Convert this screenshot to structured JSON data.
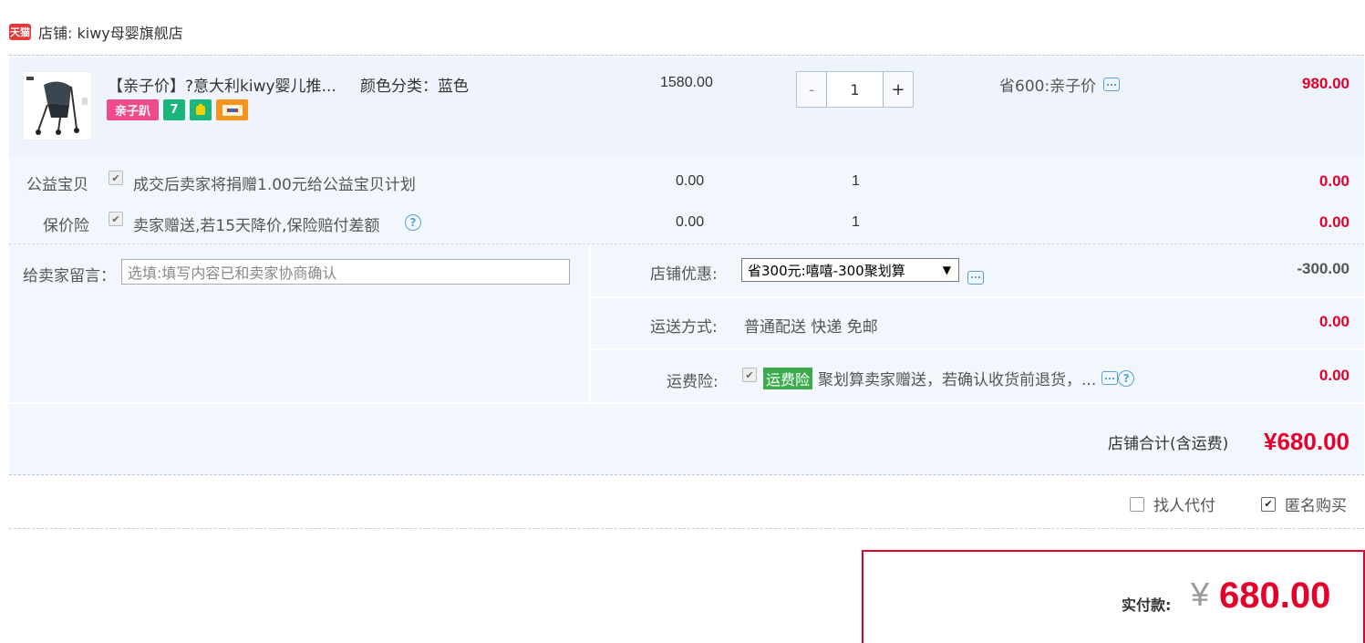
{
  "shop": {
    "logo_text": "天猫",
    "name": "店铺: kiwy母婴旗舰店"
  },
  "item": {
    "title": "【亲子价】?意大利kiwy婴儿推...",
    "sku": "颜色分类：蓝色",
    "badges": [
      "亲子趴",
      "7",
      "",
      ""
    ],
    "price": "1580.00",
    "quantity": "1",
    "qty_minus": "-",
    "qty_plus": "+",
    "promo": "省600:亲子价",
    "subtotal": "980.00"
  },
  "services": [
    {
      "label": "公益宝贝",
      "text": "成交后卖家将捐赠1.00元给公益宝贝计划",
      "price": "0.00",
      "qty": "1",
      "subtotal": "0.00"
    },
    {
      "label": "保价险",
      "text": "卖家赠送,若15天降价,保险赔付差额",
      "price": "0.00",
      "qty": "1",
      "subtotal": "0.00",
      "help": "?"
    }
  ],
  "message": {
    "label": "给卖家留言：",
    "placeholder": "选填:填写内容已和卖家协商确认"
  },
  "discount": {
    "label": "店铺优惠:",
    "selected": "省300元:嘻嘻-300聚划算",
    "arrow": "▼",
    "amount": "-300.00"
  },
  "shipping": {
    "label": "运送方式:",
    "value": "普通配送 快递 免邮",
    "amount": "0.00"
  },
  "insurance": {
    "label": "运费险:",
    "tag": "运费险",
    "text": "聚划算卖家赠送，若确认收货前退货，...",
    "amount": "0.00",
    "help": "?"
  },
  "shop_total": {
    "label": "店铺合计(含运费)",
    "amount": "¥680.00"
  },
  "options": [
    {
      "label": "找人代付",
      "checked": false
    },
    {
      "label": "匿名购买",
      "checked": true
    }
  ],
  "payment": {
    "label": "实付款:",
    "currency": "¥",
    "amount": "680.00"
  },
  "colors": {
    "accent_red": "#e4002b",
    "bg_blue": "#f2f6fd",
    "green_tag": "#3bab4e",
    "link_blue": "#5aa2d9"
  }
}
